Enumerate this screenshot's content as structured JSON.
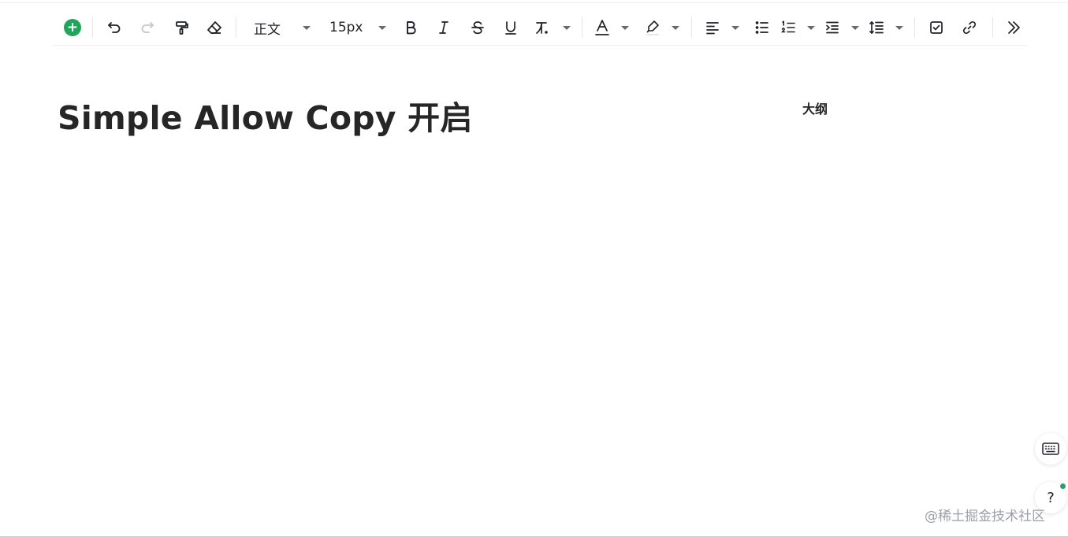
{
  "toolbar": {
    "block_style": "正文",
    "font_size": "15px"
  },
  "document": {
    "title": "Simple Allow Copy 开启"
  },
  "outline": {
    "label": "大纲"
  },
  "help": {
    "label": "?"
  },
  "watermark": "@稀土掘金技术社区",
  "colors": {
    "accent": "#1fa65a",
    "status_dot": "#2e9e6b"
  }
}
